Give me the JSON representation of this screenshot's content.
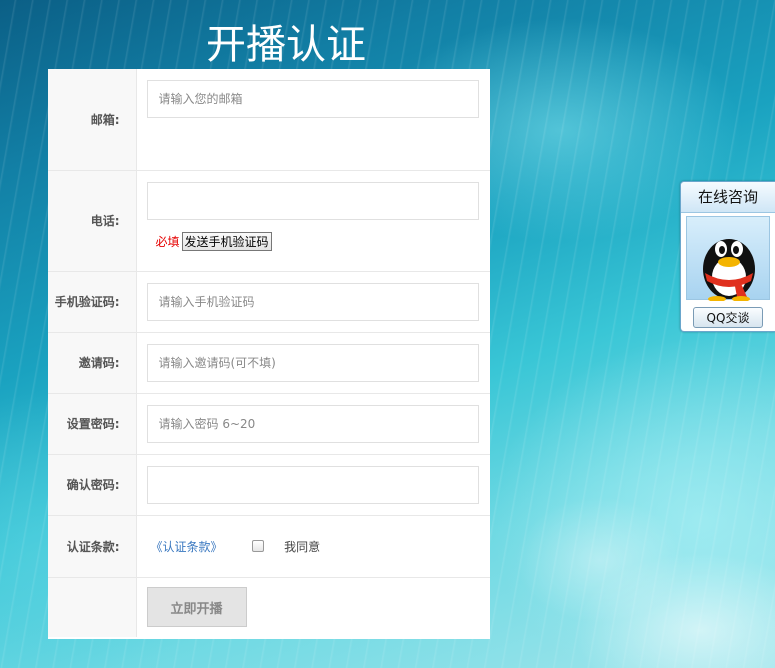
{
  "page": {
    "title": "开播认证"
  },
  "form": {
    "email": {
      "label": "邮箱:",
      "placeholder": "请输入您的邮箱",
      "value": ""
    },
    "phone": {
      "label": "电话:",
      "placeholder": "",
      "value": "",
      "required_text": "必填",
      "send_code_label": "发送手机验证码"
    },
    "sms_code": {
      "label": "手机验证码:",
      "placeholder": "请输入手机验证码"
    },
    "invite_code": {
      "label": "邀请码:",
      "placeholder": "请输入邀请码(可不填)"
    },
    "password": {
      "label": "设置密码:",
      "placeholder": "请输入密码 6~20"
    },
    "confirm_password": {
      "label": "确认密码:",
      "placeholder": ""
    },
    "terms": {
      "label": "认证条款:",
      "link_text": "《认证条款》",
      "agree_text": "我同意",
      "agreed": false
    },
    "submit_label": "立即开播"
  },
  "qq_widget": {
    "title": "在线咨询",
    "button_label": "QQ交谈",
    "avatar_icon": "qq-penguin-icon"
  },
  "colors": {
    "required": "#e60000",
    "link": "#3a78c0",
    "submit_bg": "#e4e4e4"
  }
}
